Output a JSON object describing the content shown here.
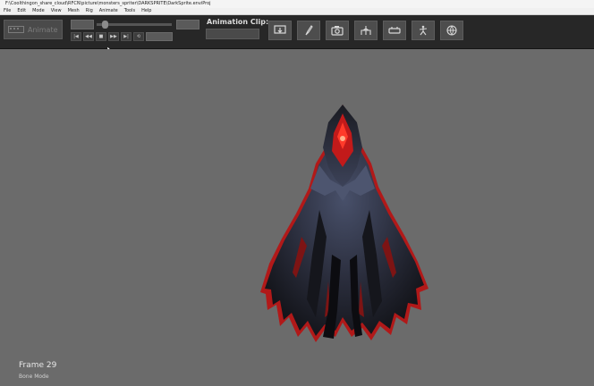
{
  "window": {
    "title": "F:\\Coolthingon_share_cloud\\RFCN\\picture\\monsters_spriter\\DARKSPRITE\\DarkSprite.enviProj"
  },
  "menu": {
    "items": [
      "File",
      "Edit",
      "Mode",
      "View",
      "Mesh",
      "Rig",
      "Animate",
      "Tools",
      "Help"
    ]
  },
  "toolbar": {
    "animate_label": "Animate",
    "animation_clip_label": "Animation Clip:",
    "clip_value": "",
    "slider_position": 0.08,
    "transport": {
      "first": "|◀",
      "prev": "◀◀",
      "stop": "■",
      "next": "▶▶",
      "last": "▶|",
      "loop": "⟲"
    },
    "icons": [
      "import-icon",
      "brush-icon",
      "camera-icon",
      "rig-icon",
      "link-icon",
      "pose-icon",
      "globe-icon"
    ]
  },
  "viewport": {
    "frame_label": "Frame 29",
    "mode_label": "Bone Mode"
  },
  "colors": {
    "toolbar_bg": "#272727",
    "viewport_bg": "#6b6b6b",
    "accent_red": "#c81a1a"
  }
}
